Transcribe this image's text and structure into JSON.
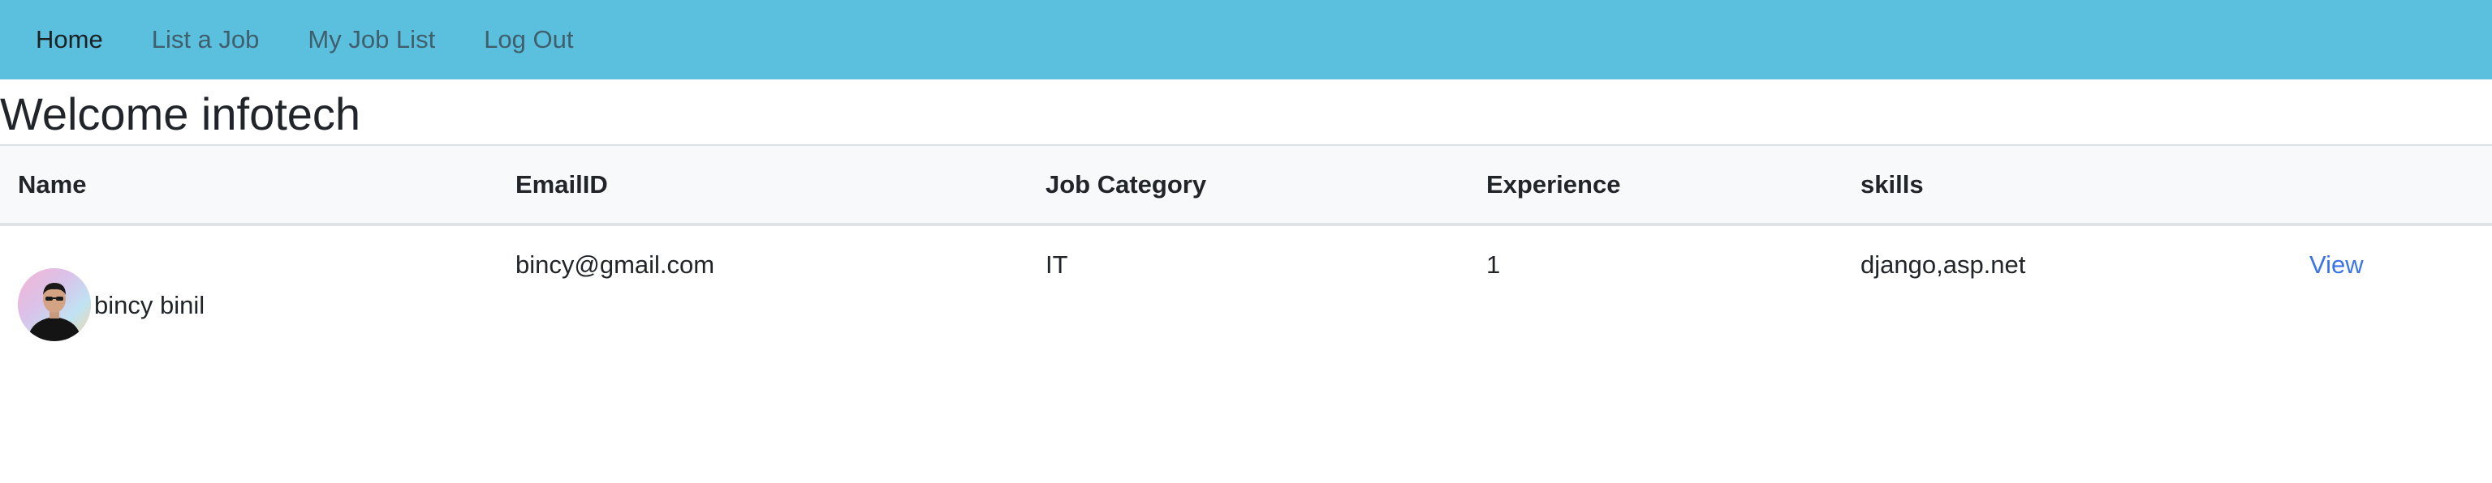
{
  "nav": {
    "items": [
      {
        "label": "Home",
        "active": true
      },
      {
        "label": "List a Job",
        "active": false
      },
      {
        "label": "My Job List",
        "active": false
      },
      {
        "label": "Log Out",
        "active": false
      }
    ],
    "background": "#5bc0de"
  },
  "page": {
    "title": "Welcome infotech"
  },
  "table": {
    "headers": [
      "Name",
      "EmailID",
      "Job Category",
      "Experience",
      "skills",
      ""
    ],
    "rows": [
      {
        "name": "bincy binil",
        "email": "bincy@gmail.com",
        "category": "IT",
        "experience": "1",
        "skills": "django,asp.net",
        "action": "View"
      }
    ]
  },
  "colors": {
    "link": "#3b73e8",
    "header_bg": "#f8f9fa"
  }
}
